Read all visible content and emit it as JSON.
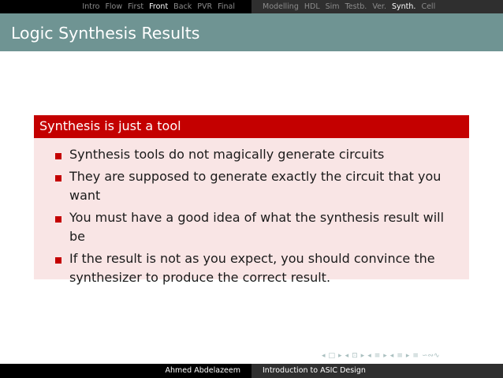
{
  "topnav": {
    "left": [
      {
        "label": "Intro",
        "active": false
      },
      {
        "label": "Flow",
        "active": false
      },
      {
        "label": "First",
        "active": false
      },
      {
        "label": "Front",
        "active": true
      },
      {
        "label": "Back",
        "active": false
      },
      {
        "label": "PVR",
        "active": false
      },
      {
        "label": "Final",
        "active": false
      }
    ],
    "right": [
      {
        "label": "Modelling",
        "active": false
      },
      {
        "label": "HDL",
        "active": false
      },
      {
        "label": "Sim",
        "active": false
      },
      {
        "label": "Testb.",
        "active": false
      },
      {
        "label": "Ver.",
        "active": false
      },
      {
        "label": "Synth.",
        "active": true
      },
      {
        "label": "Cell",
        "active": false
      }
    ]
  },
  "frame": {
    "title": "Logic Synthesis Results"
  },
  "block": {
    "title": "Synthesis is just a tool",
    "items": [
      "Synthesis tools do not magically generate circuits",
      "They are supposed to generate exactly the circuit that you want",
      "You must have a good idea of what the synthesis result will be",
      "If the result is not as you expect, you should convince the synthesizer to produce the correct result."
    ]
  },
  "nav_symbols": {
    "frame_left": "◂",
    "frame_icon": "□",
    "frame_right": "▸",
    "sub_left": "◂",
    "sub_icon": "⊡",
    "sub_right": "▸",
    "sec_left": "◂",
    "sec_icon": "≡",
    "sec_right": "▸",
    "part_left": "◂",
    "part_icon": "≡",
    "part_right": "▸",
    "align": "≡",
    "search": "∽∾∿"
  },
  "footer": {
    "author": "Ahmed Abdelazeem",
    "title": "Introduction to ASIC Design"
  },
  "colors": {
    "title_bar": "#6f9493",
    "block_title": "#c40000",
    "block_body": "#f9e5e5"
  }
}
